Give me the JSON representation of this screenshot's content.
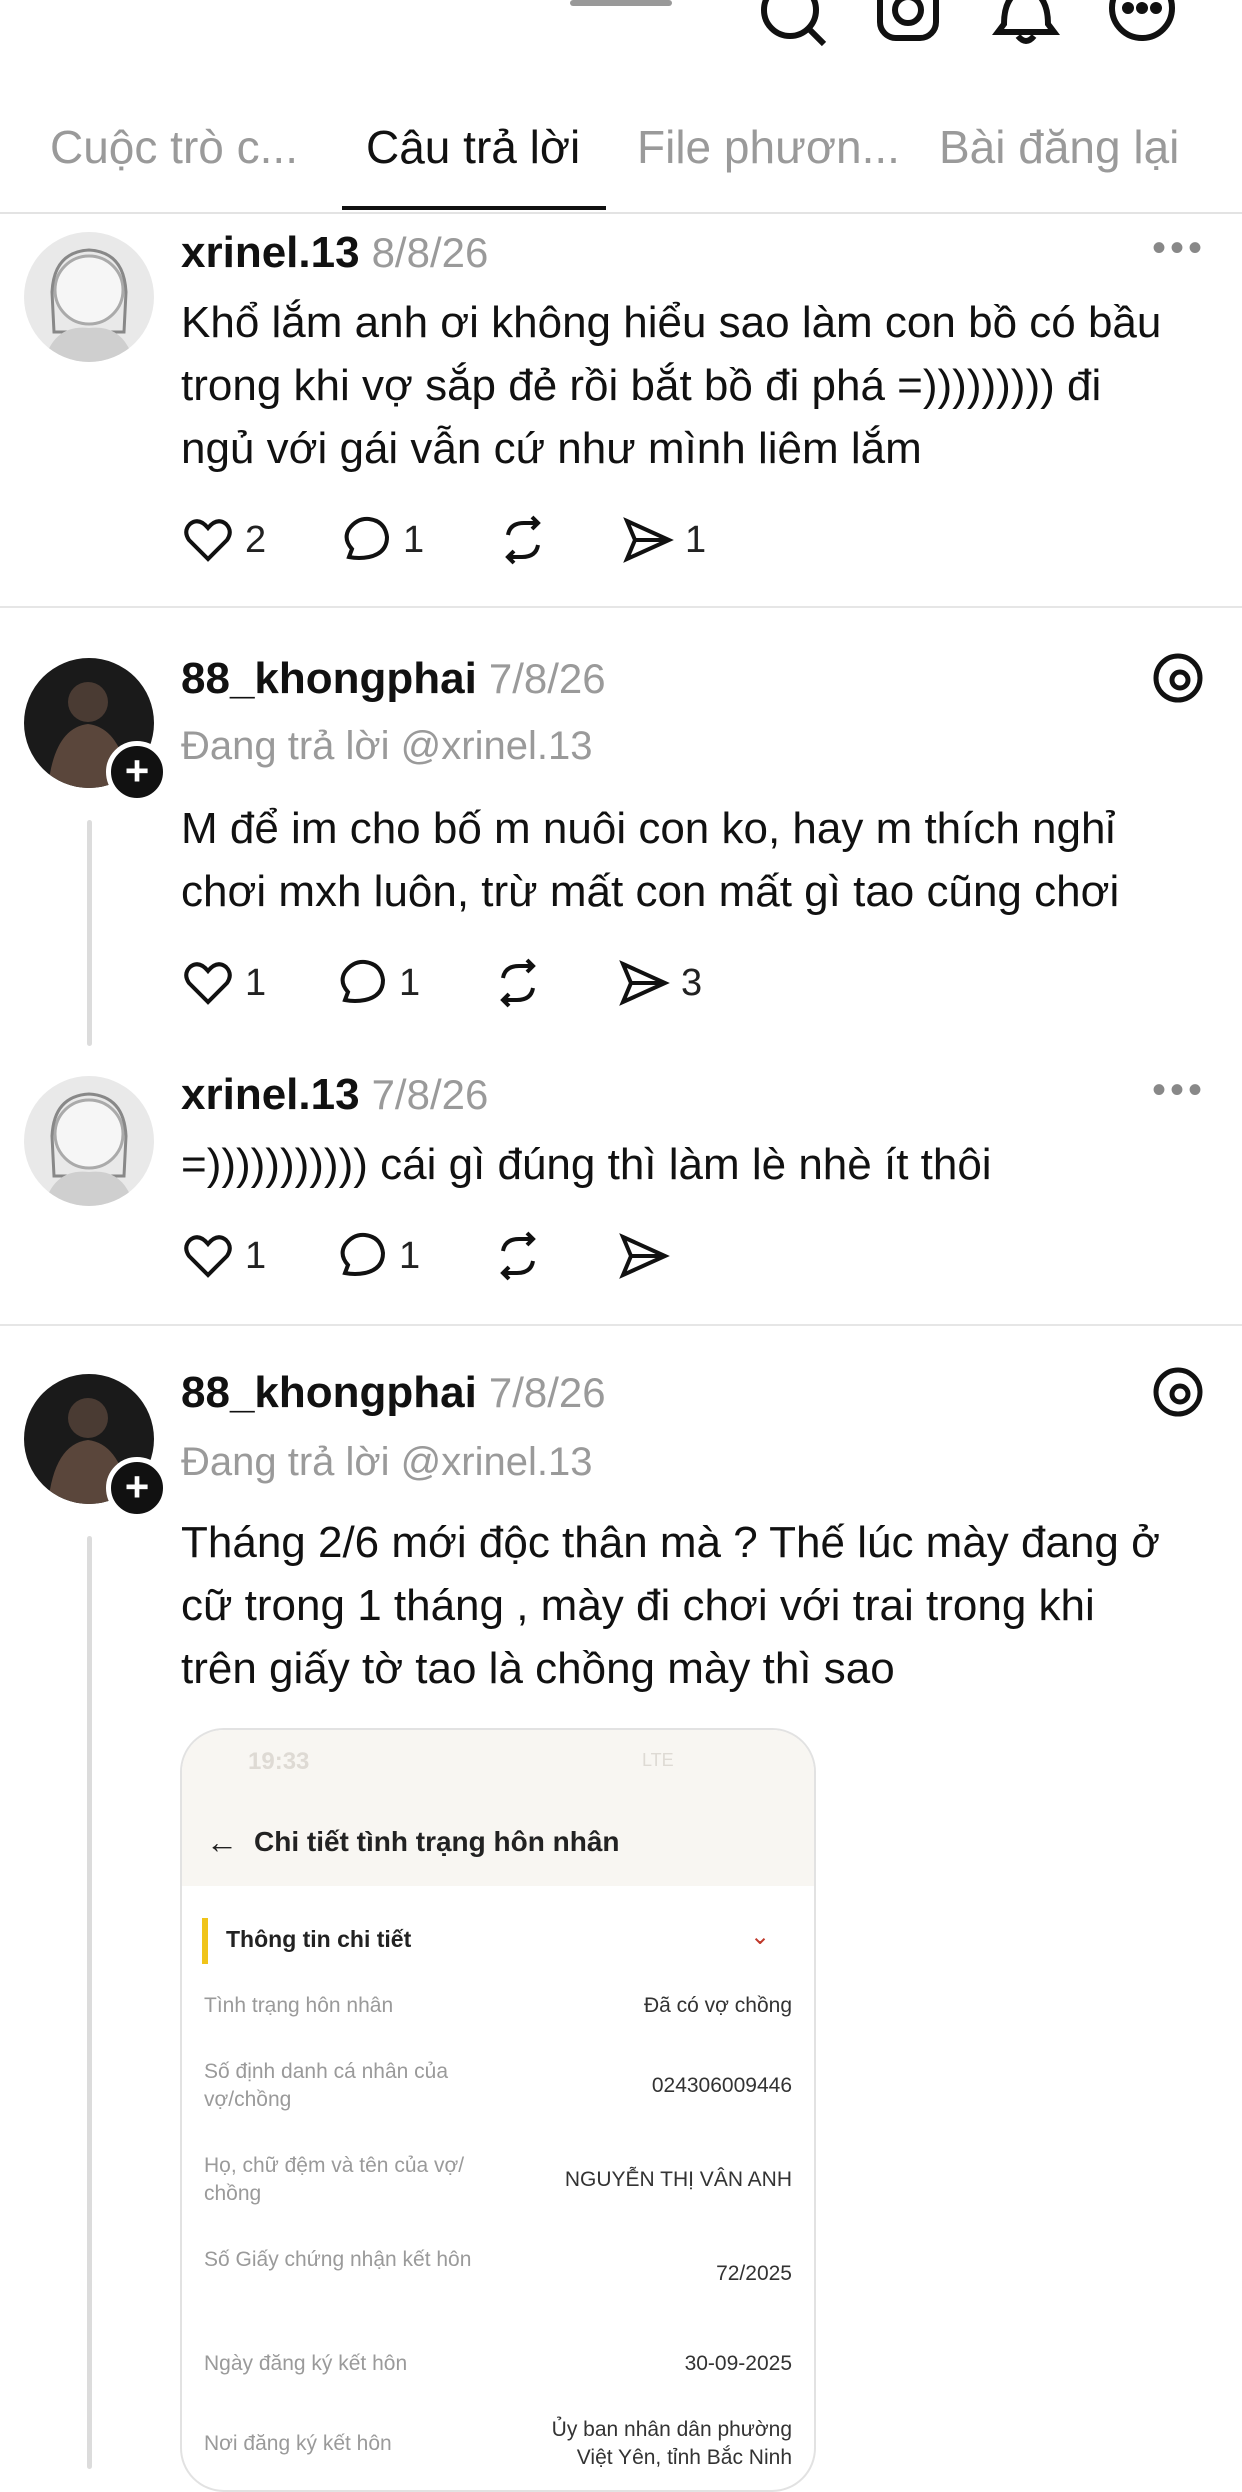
{
  "tabs": [
    {
      "label": "Cuộc trò c..."
    },
    {
      "label": "Câu trả lời"
    },
    {
      "label": "File phươn..."
    },
    {
      "label": "Bài đăng lại"
    }
  ],
  "posts": [
    {
      "username": "xrinel.13",
      "date": "8/8/26",
      "lines": [
        "Khổ lắm anh ơi không hiểu sao làm con bồ có bầu",
        "trong khi vợ sắp đẻ rồi bắt bồ đi phá =))))))))) đi",
        "ngủ với gái vẫn cứ như mình liêm lắm"
      ],
      "likes": "2",
      "comments": "1",
      "reposts": "",
      "shares": "1"
    },
    {
      "username": "88_khongphai",
      "date": "7/8/26",
      "reply_to": "Đang trả lời @xrinel.13",
      "lines": [
        "M để im cho bố m nuôi con ko, hay m thích nghỉ",
        "chơi mxh luôn, trừ mất con mất gì tao cũng chơi"
      ],
      "likes": "1",
      "comments": "1",
      "reposts": "",
      "shares": "3"
    },
    {
      "username": "xrinel.13",
      "date": "7/8/26",
      "lines": [
        "=))))))))))) cái gì đúng thì làm lè nhè ít thôi"
      ],
      "likes": "1",
      "comments": "1",
      "reposts": "",
      "shares": ""
    },
    {
      "username": "88_khongphai",
      "date": "7/8/26",
      "reply_to": "Đang trả lời @xrinel.13",
      "lines": [
        "Tháng 2/6 mới độc thân mà ? Thế lúc mày đang ở",
        "cữ trong 1 tháng , mày đi chơi với trai trong khi",
        "trên giấy tờ tao là chồng mày thì sao"
      ]
    }
  ],
  "attachment": {
    "status_time": "19:33",
    "status_right": "LTE",
    "title": "Chi tiết tình trạng hôn nhân",
    "section": "Thông tin chi tiết",
    "rows": [
      {
        "label": "Tình trạng hôn nhân",
        "value": "Đã có vợ chồng"
      },
      {
        "label": "Số định danh cá nhân của vợ/chồng",
        "value": "024306009446"
      },
      {
        "label": "Họ, chữ đệm và tên của vợ/ chồng",
        "value": "NGUYỄN THỊ VÂN ANH"
      },
      {
        "label": "Số Giấy chứng nhận kết hôn",
        "value": "72/2025"
      },
      {
        "label": "Ngày đăng ký kết hôn",
        "value": "30-09-2025"
      },
      {
        "label": "Nơi đăng ký kết hôn",
        "value": "Ủy ban nhân dân phường Việt Yên, tỉnh Bắc Ninh"
      }
    ]
  }
}
